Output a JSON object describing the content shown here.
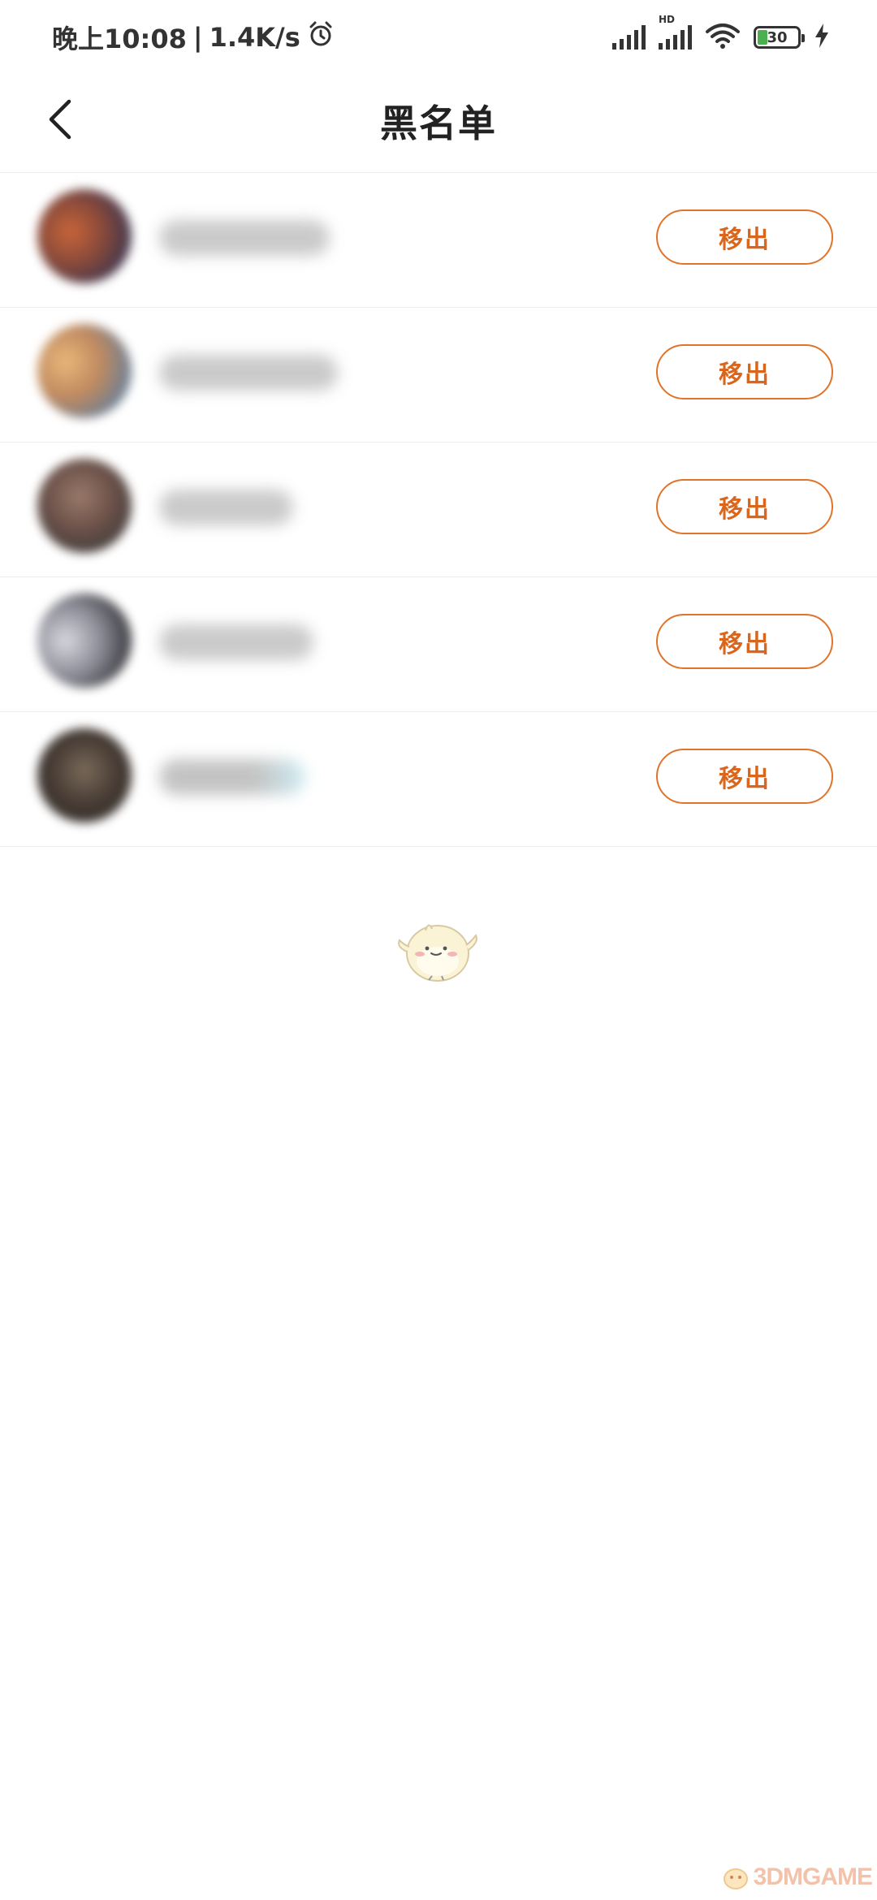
{
  "status_bar": {
    "time": "晚上10:08",
    "separator": "|",
    "net_speed": "1.4K/s",
    "alarm_icon": "alarm-clock-icon",
    "hd_label": "HD",
    "battery_level": "30",
    "battery_color": "#4caf50"
  },
  "header": {
    "back_icon": "chevron-left-icon",
    "title": "黑名单"
  },
  "blacklist": {
    "remove_label": "移出",
    "accent_color": "#d9661c",
    "items": [
      {
        "name": "",
        "avatar_colors": [
          "#c8653a",
          "#3a3550"
        ]
      },
      {
        "name": "",
        "avatar_colors": [
          "#e0a86a",
          "#5a7da0"
        ]
      },
      {
        "name": "",
        "avatar_colors": [
          "#8a6a5a",
          "#3a3a3a"
        ]
      },
      {
        "name": "",
        "avatar_colors": [
          "#c8c8d0",
          "#303035"
        ]
      },
      {
        "name": "",
        "avatar_colors": [
          "#6a5a4a",
          "#2e2a28"
        ]
      }
    ]
  },
  "watermark": {
    "text": "3DMGAME"
  }
}
